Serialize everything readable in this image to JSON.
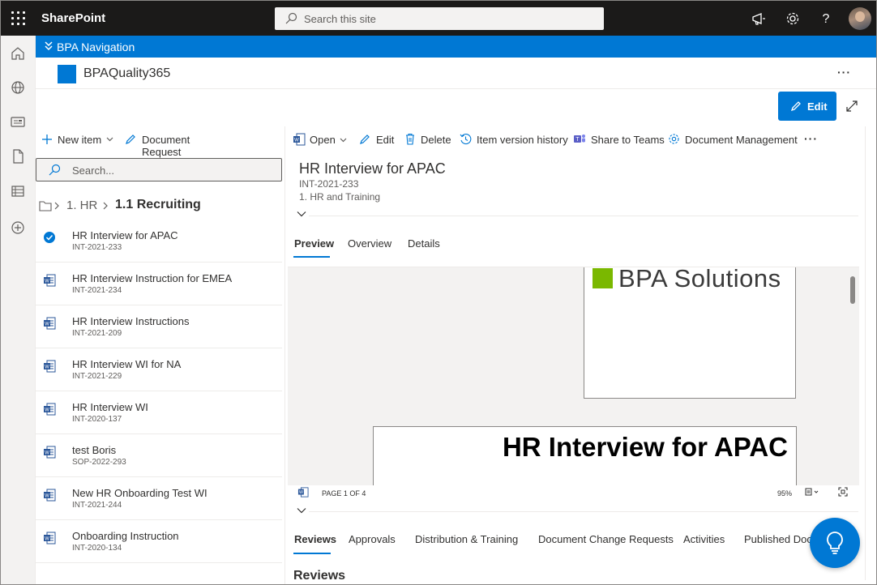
{
  "suite": {
    "app_name": "SharePoint",
    "search_placeholder": "Search this site",
    "icons": [
      "waffle-icon",
      "megaphone-icon",
      "gear-icon",
      "help-icon",
      "avatar"
    ]
  },
  "rail": {
    "icons": [
      "home-icon",
      "globe-icon",
      "news-icon",
      "document-icon",
      "list-icon",
      "add-icon"
    ]
  },
  "hub": {
    "title": "BPA Navigation"
  },
  "site": {
    "title": "BPAQuality365",
    "more": "···"
  },
  "page_actions": {
    "edit_label": "Edit"
  },
  "list": {
    "commands": {
      "new_item": "New item",
      "document_request": "Document Request"
    },
    "search_placeholder": "Search...",
    "breadcrumb": [
      "1. HR",
      "1.1 Recruiting"
    ],
    "items": [
      {
        "title": "HR Interview for APAC",
        "id": "INT-2021-233",
        "selected": true
      },
      {
        "title": "HR Interview Instruction for EMEA",
        "id": "INT-2021-234"
      },
      {
        "title": "HR Interview Instructions",
        "id": "INT-2021-209"
      },
      {
        "title": "HR Interview WI for NA",
        "id": "INT-2021-229"
      },
      {
        "title": "HR Interview WI",
        "id": "INT-2020-137"
      },
      {
        "title": "test Boris",
        "id": "SOP-2022-293"
      },
      {
        "title": "New HR Onboarding Test WI",
        "id": "INT-2021-244"
      },
      {
        "title": "Onboarding Instruction",
        "id": "INT-2020-134"
      }
    ]
  },
  "detail": {
    "commands": {
      "open": "Open",
      "edit": "Edit",
      "delete": "Delete",
      "version_history": "Item version history",
      "share_teams": "Share to Teams",
      "doc_mgmt": "Document Management",
      "more": "···"
    },
    "title": "HR Interview for APAC",
    "id": "INT-2021-233",
    "category": "1. HR and Training",
    "tabs": [
      "Preview",
      "Overview",
      "Details"
    ],
    "active_tab": "Preview",
    "preview": {
      "logo_text": "BPA Solutions",
      "doc_heading": "HR Interview for APAC",
      "page_label": "PAGE 1 OF 4",
      "zoom": "95%"
    },
    "bottom_tabs": [
      "Reviews",
      "Approvals",
      "Distribution & Training",
      "Document Change Requests",
      "Activities",
      "Published Docu"
    ],
    "active_bottom_tab": "Reviews",
    "section_title": "Reviews"
  },
  "colors": {
    "accent": "#0078d4",
    "suite_bar": "#1b1a19",
    "bpa_green": "#7ab800"
  }
}
